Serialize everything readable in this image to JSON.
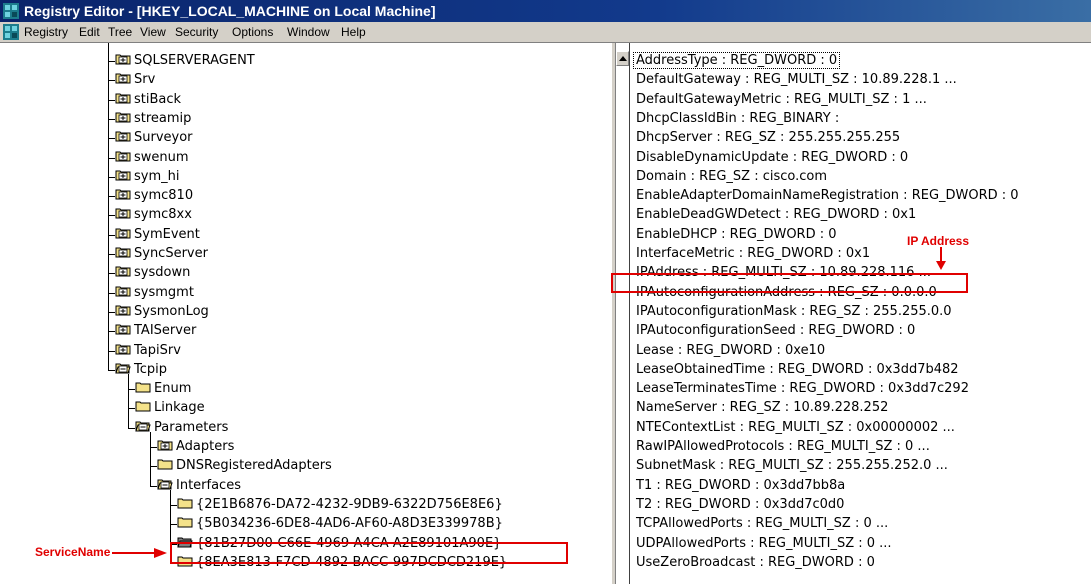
{
  "window": {
    "title": "Registry Editor - [HKEY_LOCAL_MACHINE on Local Machine]"
  },
  "menu": [
    "Registry",
    "Edit",
    "Tree",
    "View",
    "Security",
    "Options",
    "Window",
    "Help"
  ],
  "tree": {
    "items": [
      {
        "label": "SQLSERVERAGENT",
        "level": 0,
        "state": "plus"
      },
      {
        "label": "Srv",
        "level": 0,
        "state": "plus"
      },
      {
        "label": "stiBack",
        "level": 0,
        "state": "plus"
      },
      {
        "label": "streamip",
        "level": 0,
        "state": "plus"
      },
      {
        "label": "Surveyor",
        "level": 0,
        "state": "plus"
      },
      {
        "label": "swenum",
        "level": 0,
        "state": "plus"
      },
      {
        "label": "sym_hi",
        "level": 0,
        "state": "plus"
      },
      {
        "label": "symc810",
        "level": 0,
        "state": "plus"
      },
      {
        "label": "symc8xx",
        "level": 0,
        "state": "plus"
      },
      {
        "label": "SymEvent",
        "level": 0,
        "state": "plus"
      },
      {
        "label": "SyncServer",
        "level": 0,
        "state": "plus"
      },
      {
        "label": "sysdown",
        "level": 0,
        "state": "plus"
      },
      {
        "label": "sysmgmt",
        "level": 0,
        "state": "plus"
      },
      {
        "label": "SysmonLog",
        "level": 0,
        "state": "plus"
      },
      {
        "label": "TAIServer",
        "level": 0,
        "state": "plus"
      },
      {
        "label": "TapiSrv",
        "level": 0,
        "state": "plus"
      },
      {
        "label": "Tcpip",
        "level": 0,
        "state": "minus"
      },
      {
        "label": "Enum",
        "level": 1,
        "state": "none"
      },
      {
        "label": "Linkage",
        "level": 1,
        "state": "none"
      },
      {
        "label": "Parameters",
        "level": 1,
        "state": "minus"
      },
      {
        "label": "Adapters",
        "level": 2,
        "state": "plus"
      },
      {
        "label": "DNSRegisteredAdapters",
        "level": 2,
        "state": "none"
      },
      {
        "label": "Interfaces",
        "level": 2,
        "state": "minus"
      },
      {
        "label": "{2E1B6876-DA72-4232-9DB9-6322D756E8E6}",
        "level": 3,
        "state": "none"
      },
      {
        "label": "{5B034236-6DE8-4AD6-AF60-A8D3E339978B}",
        "level": 3,
        "state": "none"
      },
      {
        "label": "{81B27D00-C66E-4969-A4CA-A2E89101A90E}",
        "level": 3,
        "state": "open"
      },
      {
        "label": "{8EA3E813-F7CD-4892-BACC-997DCDCD219E}",
        "level": 3,
        "state": "none"
      }
    ]
  },
  "values": [
    "AddressType : REG_DWORD : 0",
    "DefaultGateway : REG_MULTI_SZ : 10.89.228.1 ...",
    "DefaultGatewayMetric : REG_MULTI_SZ : 1 ...",
    "DhcpClassIdBin : REG_BINARY :",
    "DhcpServer : REG_SZ : 255.255.255.255",
    "DisableDynamicUpdate : REG_DWORD : 0",
    "Domain : REG_SZ : cisco.com",
    "EnableAdapterDomainNameRegistration : REG_DWORD : 0",
    "EnableDeadGWDetect : REG_DWORD : 0x1",
    "EnableDHCP : REG_DWORD : 0",
    "InterfaceMetric : REG_DWORD : 0x1",
    "IPAddress : REG_MULTI_SZ : 10.89.228.116 ...",
    "IPAutoconfigurationAddress : REG_SZ : 0.0.0.0",
    "IPAutoconfigurationMask : REG_SZ : 255.255.0.0",
    "IPAutoconfigurationSeed : REG_DWORD : 0",
    "Lease : REG_DWORD : 0xe10",
    "LeaseObtainedTime : REG_DWORD : 0x3dd7b482",
    "LeaseTerminatesTime : REG_DWORD : 0x3dd7c292",
    "NameServer : REG_SZ : 10.89.228.252",
    "NTEContextList : REG_MULTI_SZ : 0x00000002 ...",
    "RawIPAllowedProtocols : REG_MULTI_SZ : 0 ...",
    "SubnetMask : REG_MULTI_SZ : 255.255.252.0 ...",
    "T1 : REG_DWORD : 0x3dd7bb8a",
    "T2 : REG_DWORD : 0x3dd7c0d0",
    "TCPAllowedPorts : REG_MULTI_SZ : 0 ...",
    "UDPAllowedPorts : REG_MULTI_SZ : 0 ...",
    "UseZeroBroadcast : REG_DWORD : 0"
  ],
  "annotations": {
    "ip_label": "IP Address",
    "service_label": "ServiceName"
  },
  "colors": {
    "annotation": "#e00000",
    "title_bar": "#0a246a",
    "folder_fill": "#f4e28a"
  }
}
